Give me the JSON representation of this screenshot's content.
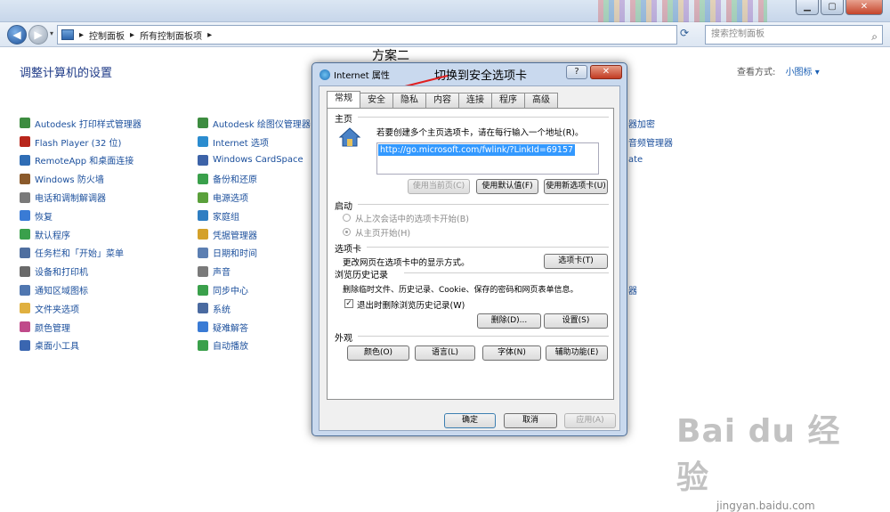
{
  "window": {
    "min": "▁",
    "max": "▢",
    "close": "✕"
  },
  "address": {
    "crumbs": [
      "控制面板",
      "所有控制面板项"
    ],
    "search_placeholder": "搜索控制面板"
  },
  "page": {
    "title": "调整计算机的设置",
    "view_label": "查看方式:",
    "view_value": "小图标 ▾"
  },
  "annotation_top": "方案二",
  "col1": [
    {
      "label": "Autodesk 打印样式管理器",
      "color": "#3d8c40"
    },
    {
      "label": "Flash Player (32 位)",
      "color": "#b8261b"
    },
    {
      "label": "RemoteApp 和桌面连接",
      "color": "#2f6db5"
    },
    {
      "label": "Windows 防火墙",
      "color": "#8b5a2b"
    },
    {
      "label": "电话和调制解调器",
      "color": "#7a7a7a"
    },
    {
      "label": "恢复",
      "color": "#3a7bd5"
    },
    {
      "label": "默认程序",
      "color": "#3aa04b"
    },
    {
      "label": "任务栏和「开始」菜单",
      "color": "#4f6fa0"
    },
    {
      "label": "设备和打印机",
      "color": "#6a6a6a"
    },
    {
      "label": "通知区域图标",
      "color": "#5077b0"
    },
    {
      "label": "文件夹选项",
      "color": "#e0b040"
    },
    {
      "label": "颜色管理",
      "color": "#c04a8a"
    },
    {
      "label": "桌面小工具",
      "color": "#3a66b0"
    }
  ],
  "col2": [
    {
      "label": "Autodesk 绘图仪管理器",
      "color": "#3d8c40"
    },
    {
      "label": "Internet 选项",
      "color": "#2b8ccf"
    },
    {
      "label": "Windows CardSpace",
      "color": "#3d63a8"
    },
    {
      "label": "备份和还原",
      "color": "#3aa04b"
    },
    {
      "label": "电源选项",
      "color": "#5aa03b"
    },
    {
      "label": "家庭组",
      "color": "#2f7ec2"
    },
    {
      "label": "凭据管理器",
      "color": "#d4a12a"
    },
    {
      "label": "日期和时间",
      "color": "#5c7fb2"
    },
    {
      "label": "声音",
      "color": "#7a7a7a"
    },
    {
      "label": "同步中心",
      "color": "#3aa04b"
    },
    {
      "label": "系统",
      "color": "#4a6aa0"
    },
    {
      "label": "疑难解答",
      "color": "#3a7bd5"
    },
    {
      "label": "自动播放",
      "color": "#3aa04b"
    }
  ],
  "col3_partial": [
    "器加密",
    "音频管理器",
    "ate",
    "",
    "",
    "",
    "",
    "",
    "",
    "器"
  ],
  "dialog": {
    "title": "Internet 属性",
    "annotation": "切换到安全选项卡",
    "help": "?",
    "close": "✕",
    "tabs": [
      "常规",
      "安全",
      "隐私",
      "内容",
      "连接",
      "程序",
      "高级"
    ],
    "homepage": {
      "section": "主页",
      "desc": "若要创建多个主页选项卡，请在每行输入一个地址(R)。",
      "url": "http://go.microsoft.com/fwlink/?LinkId=69157",
      "btn_current": "使用当前页(C)",
      "btn_default": "使用默认值(F)",
      "btn_new": "使用新选项卡(U)"
    },
    "startup": {
      "section": "启动",
      "opt1": "从上次会话中的选项卡开始(B)",
      "opt2": "从主页开始(H)"
    },
    "tabs_section": {
      "section": "选项卡",
      "desc": "更改网页在选项卡中的显示方式。",
      "btn": "选项卡(T)"
    },
    "history": {
      "section": "浏览历史记录",
      "desc": "删除临时文件、历史记录、Cookie、保存的密码和网页表单信息。",
      "check": "退出时删除浏览历史记录(W)",
      "btn_delete": "删除(D)...",
      "btn_settings": "设置(S)"
    },
    "appearance": {
      "section": "外观",
      "btn_colors": "颜色(O)",
      "btn_lang": "语言(L)",
      "btn_fonts": "字体(N)",
      "btn_access": "辅助功能(E)"
    },
    "ok": "确定",
    "cancel": "取消",
    "apply": "应用(A)"
  },
  "watermark": {
    "brand": "Bai du 经验",
    "url": "jingyan.baidu.com"
  }
}
